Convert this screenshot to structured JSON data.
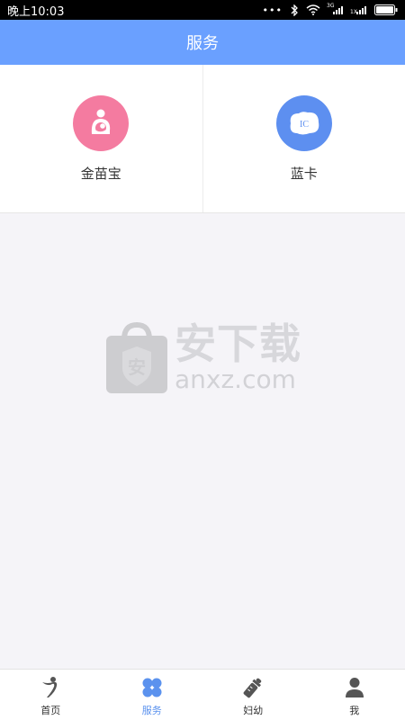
{
  "status_bar": {
    "time": "晚上10:03",
    "network_label": "3G",
    "sim_label": "1X"
  },
  "header": {
    "title": "服务"
  },
  "services": [
    {
      "label": "金苗宝",
      "icon": "breastfeeding-icon",
      "color": "#f47ba0"
    },
    {
      "label": "蓝卡",
      "icon": "ic-card-icon",
      "color": "#5d8ff0",
      "icon_text": "IC"
    }
  ],
  "watermark": {
    "cn": "安下载",
    "en": "anxz.com",
    "badge_text": "安"
  },
  "tabs": [
    {
      "label": "首页",
      "icon": "figure-icon",
      "active": false
    },
    {
      "label": "服务",
      "icon": "grid-icon",
      "active": true
    },
    {
      "label": "妇幼",
      "icon": "baby-bottle-icon",
      "active": false
    },
    {
      "label": "我",
      "icon": "person-icon",
      "active": false
    }
  ],
  "colors": {
    "accent": "#6aa0ff",
    "tab_active": "#5b92ee",
    "tab_icon": "#555555"
  }
}
